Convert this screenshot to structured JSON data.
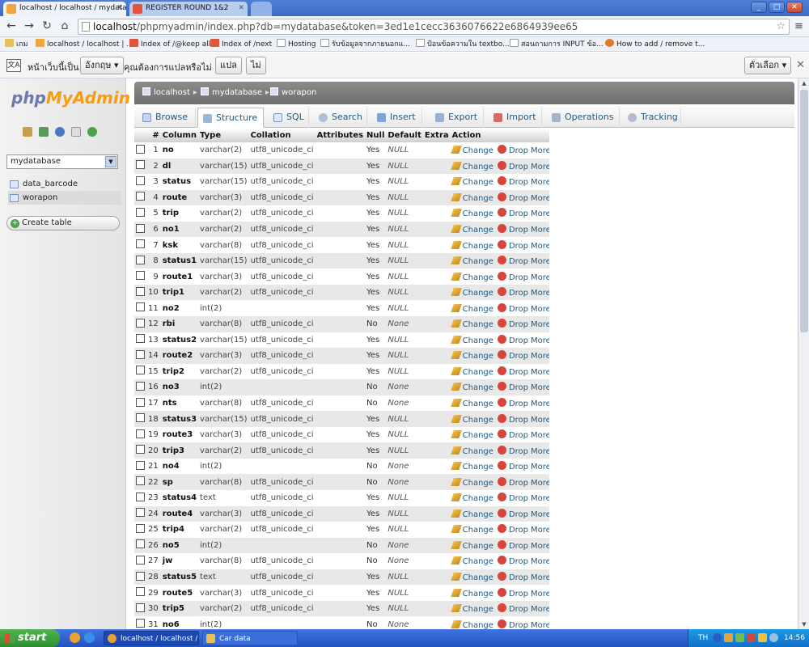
{
  "browser": {
    "tabs": [
      {
        "label": "localhost / localhost / mydata"
      },
      {
        "label": "REGISTER ROUND 1&2"
      }
    ],
    "url_host": "localhost",
    "url_rest": "/phpmyadmin/index.php?db=mydatabase&token=3ed1e1cecc3636076622e6864939ee65",
    "bookmarks": [
      "เกม",
      "localhost / localhost | ...",
      "Index of /@keep all",
      "Index of /next",
      "Hosting",
      "รับข้อมูลจากภายนอกแ...",
      "ป้อนข้อความใน textbo...",
      "สอนถามการ INPUT ข้อ...",
      "How to add / remove t..."
    ],
    "translate": {
      "prefix": "หน้าเว็บนี้เป็น",
      "language": "อังกฤษ",
      "question": "คุณต้องการแปลหรือไม่",
      "translate_btn": "แปล",
      "no_btn": "ไม่",
      "options_btn": "ตัวเลือก"
    }
  },
  "sidebar": {
    "logo_php": "php",
    "logo_ma": "MyAdmin",
    "db_selected": "mydatabase",
    "tables": [
      "data_barcode",
      "worapon"
    ],
    "create_table": "Create table"
  },
  "breadcrumb": [
    "localhost",
    "mydatabase",
    "worapon"
  ],
  "tabs": [
    "Browse",
    "Structure",
    "SQL",
    "Search",
    "Insert",
    "Export",
    "Import",
    "Operations",
    "Tracking"
  ],
  "table": {
    "headers": [
      "#",
      "Column",
      "Type",
      "Collation",
      "Attributes",
      "Null",
      "Default",
      "Extra",
      "Action"
    ],
    "action_labels": {
      "change": "Change",
      "drop": "Drop",
      "more": "More"
    },
    "rows": [
      {
        "n": "1",
        "name": "no",
        "type": "varchar(2)",
        "coll": "utf8_unicode_ci",
        "null": "Yes",
        "def": "NULL"
      },
      {
        "n": "2",
        "name": "dl",
        "type": "varchar(15)",
        "coll": "utf8_unicode_ci",
        "null": "Yes",
        "def": "NULL"
      },
      {
        "n": "3",
        "name": "status",
        "type": "varchar(15)",
        "coll": "utf8_unicode_ci",
        "null": "Yes",
        "def": "NULL"
      },
      {
        "n": "4",
        "name": "route",
        "type": "varchar(3)",
        "coll": "utf8_unicode_ci",
        "null": "Yes",
        "def": "NULL"
      },
      {
        "n": "5",
        "name": "trip",
        "type": "varchar(2)",
        "coll": "utf8_unicode_ci",
        "null": "Yes",
        "def": "NULL"
      },
      {
        "n": "6",
        "name": "no1",
        "type": "varchar(2)",
        "coll": "utf8_unicode_ci",
        "null": "Yes",
        "def": "NULL"
      },
      {
        "n": "7",
        "name": "ksk",
        "type": "varchar(8)",
        "coll": "utf8_unicode_ci",
        "null": "Yes",
        "def": "NULL"
      },
      {
        "n": "8",
        "name": "status1",
        "type": "varchar(15)",
        "coll": "utf8_unicode_ci",
        "null": "Yes",
        "def": "NULL"
      },
      {
        "n": "9",
        "name": "route1",
        "type": "varchar(3)",
        "coll": "utf8_unicode_ci",
        "null": "Yes",
        "def": "NULL"
      },
      {
        "n": "10",
        "name": "trip1",
        "type": "varchar(2)",
        "coll": "utf8_unicode_ci",
        "null": "Yes",
        "def": "NULL"
      },
      {
        "n": "11",
        "name": "no2",
        "type": "int(2)",
        "coll": "",
        "null": "Yes",
        "def": "NULL"
      },
      {
        "n": "12",
        "name": "rbi",
        "type": "varchar(8)",
        "coll": "utf8_unicode_ci",
        "null": "No",
        "def": "None"
      },
      {
        "n": "13",
        "name": "status2",
        "type": "varchar(15)",
        "coll": "utf8_unicode_ci",
        "null": "Yes",
        "def": "NULL"
      },
      {
        "n": "14",
        "name": "route2",
        "type": "varchar(3)",
        "coll": "utf8_unicode_ci",
        "null": "Yes",
        "def": "NULL"
      },
      {
        "n": "15",
        "name": "trip2",
        "type": "varchar(2)",
        "coll": "utf8_unicode_ci",
        "null": "Yes",
        "def": "NULL"
      },
      {
        "n": "16",
        "name": "no3",
        "type": "int(2)",
        "coll": "",
        "null": "No",
        "def": "None"
      },
      {
        "n": "17",
        "name": "nts",
        "type": "varchar(8)",
        "coll": "utf8_unicode_ci",
        "null": "No",
        "def": "None"
      },
      {
        "n": "18",
        "name": "status3",
        "type": "varchar(15)",
        "coll": "utf8_unicode_ci",
        "null": "Yes",
        "def": "NULL"
      },
      {
        "n": "19",
        "name": "route3",
        "type": "varchar(3)",
        "coll": "utf8_unicode_ci",
        "null": "Yes",
        "def": "NULL"
      },
      {
        "n": "20",
        "name": "trip3",
        "type": "varchar(2)",
        "coll": "utf8_unicode_ci",
        "null": "Yes",
        "def": "NULL"
      },
      {
        "n": "21",
        "name": "no4",
        "type": "int(2)",
        "coll": "",
        "null": "No",
        "def": "None"
      },
      {
        "n": "22",
        "name": "sp",
        "type": "varchar(8)",
        "coll": "utf8_unicode_ci",
        "null": "No",
        "def": "None"
      },
      {
        "n": "23",
        "name": "status4",
        "type": "text",
        "coll": "utf8_unicode_ci",
        "null": "Yes",
        "def": "NULL"
      },
      {
        "n": "24",
        "name": "route4",
        "type": "varchar(3)",
        "coll": "utf8_unicode_ci",
        "null": "Yes",
        "def": "NULL"
      },
      {
        "n": "25",
        "name": "trip4",
        "type": "varchar(2)",
        "coll": "utf8_unicode_ci",
        "null": "Yes",
        "def": "NULL"
      },
      {
        "n": "26",
        "name": "no5",
        "type": "int(2)",
        "coll": "",
        "null": "No",
        "def": "None"
      },
      {
        "n": "27",
        "name": "jw",
        "type": "varchar(8)",
        "coll": "utf8_unicode_ci",
        "null": "No",
        "def": "None"
      },
      {
        "n": "28",
        "name": "status5",
        "type": "text",
        "coll": "utf8_unicode_ci",
        "null": "Yes",
        "def": "NULL"
      },
      {
        "n": "29",
        "name": "route5",
        "type": "varchar(3)",
        "coll": "utf8_unicode_ci",
        "null": "Yes",
        "def": "NULL"
      },
      {
        "n": "30",
        "name": "trip5",
        "type": "varchar(2)",
        "coll": "utf8_unicode_ci",
        "null": "Yes",
        "def": "NULL"
      },
      {
        "n": "31",
        "name": "no6",
        "type": "int(2)",
        "coll": "",
        "null": "No",
        "def": "None"
      }
    ]
  },
  "taskbar": {
    "start": "start",
    "tasks": [
      "localhost / localhost / ...",
      "Car data"
    ],
    "lang": "TH",
    "clock": "14:56"
  },
  "colors": {
    "pma_blue": "#235a81",
    "logo_orange": "#f89c0e",
    "logo_purple": "#6c78af",
    "taskbar_blue": "#2452c0"
  }
}
